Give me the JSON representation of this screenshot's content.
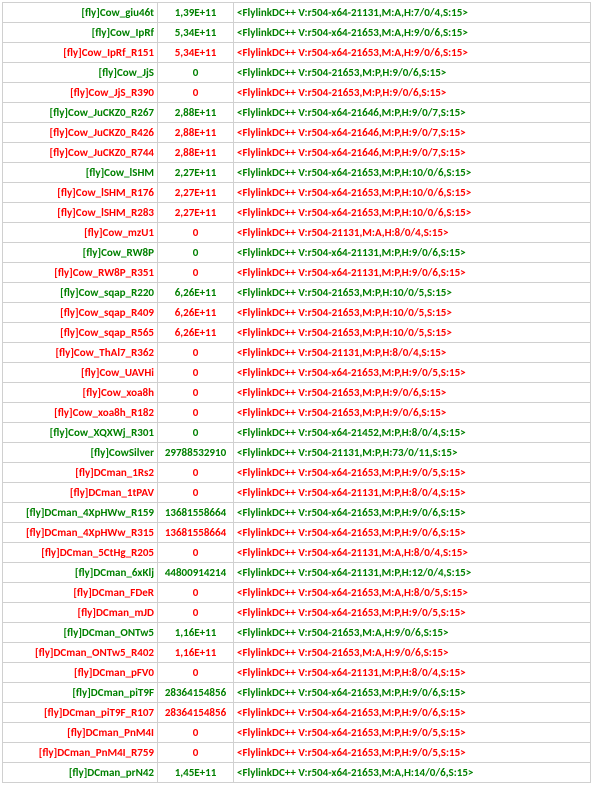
{
  "colors": {
    "green": "#008000",
    "red": "#ff0000"
  },
  "rows": [
    {
      "nick": "[fly]Cow_giu46t",
      "value": "1,39E+11",
      "info": "<FlylinkDC++ V:r504-x64-21131,M:A,H:7/0/4,S:15>",
      "color": "green"
    },
    {
      "nick": "[fly]Cow_IpRf",
      "value": "5,34E+11",
      "info": "<FlylinkDC++ V:r504-x64-21653,M:A,H:9/0/6,S:15>",
      "color": "green"
    },
    {
      "nick": "[fly]Cow_IpRf_R151",
      "value": "5,34E+11",
      "info": "<FlylinkDC++ V:r504-x64-21653,M:A,H:9/0/6,S:15>",
      "color": "red"
    },
    {
      "nick": "[fly]Cow_JjS",
      "value": "0",
      "info": "<FlylinkDC++ V:r504-21653,M:P,H:9/0/6,S:15>",
      "color": "green"
    },
    {
      "nick": "[fly]Cow_JjS_R390",
      "value": "0",
      "info": "<FlylinkDC++ V:r504-21653,M:P,H:9/0/6,S:15>",
      "color": "red"
    },
    {
      "nick": "[fly]Cow_JuCKZ0_R267",
      "value": "2,88E+11",
      "info": "<FlylinkDC++ V:r504-x64-21646,M:P,H:9/0/7,S:15>",
      "color": "green"
    },
    {
      "nick": "[fly]Cow_JuCKZ0_R426",
      "value": "2,88E+11",
      "info": "<FlylinkDC++ V:r504-x64-21646,M:P,H:9/0/7,S:15>",
      "color": "red"
    },
    {
      "nick": "[fly]Cow_JuCKZ0_R744",
      "value": "2,88E+11",
      "info": "<FlylinkDC++ V:r504-x64-21646,M:P,H:9/0/7,S:15>",
      "color": "red"
    },
    {
      "nick": "[fly]Cow_lSHM",
      "value": "2,27E+11",
      "info": "<FlylinkDC++ V:r504-x64-21653,M:P,H:10/0/6,S:15>",
      "color": "green"
    },
    {
      "nick": "[fly]Cow_lSHM_R176",
      "value": "2,27E+11",
      "info": "<FlylinkDC++ V:r504-x64-21653,M:P,H:10/0/6,S:15>",
      "color": "red"
    },
    {
      "nick": "[fly]Cow_lSHM_R283",
      "value": "2,27E+11",
      "info": "<FlylinkDC++ V:r504-x64-21653,M:P,H:10/0/6,S:15>",
      "color": "red"
    },
    {
      "nick": "[fly]Cow_mzU1",
      "value": "0",
      "info": "<FlylinkDC++ V:r504-21131,M:A,H:8/0/4,S:15>",
      "color": "red"
    },
    {
      "nick": "[fly]Cow_RW8P",
      "value": "0",
      "info": "<FlylinkDC++ V:r504-x64-21131,M:P,H:9/0/6,S:15>",
      "color": "green"
    },
    {
      "nick": "[fly]Cow_RW8P_R351",
      "value": "0",
      "info": "<FlylinkDC++ V:r504-x64-21131,M:P,H:9/0/6,S:15>",
      "color": "red"
    },
    {
      "nick": "[fly]Cow_sqap_R220",
      "value": "6,26E+11",
      "info": "<FlylinkDC++ V:r504-21653,M:P,H:10/0/5,S:15>",
      "color": "green"
    },
    {
      "nick": "[fly]Cow_sqap_R409",
      "value": "6,26E+11",
      "info": "<FlylinkDC++ V:r504-21653,M:P,H:10/0/5,S:15>",
      "color": "red"
    },
    {
      "nick": "[fly]Cow_sqap_R565",
      "value": "6,26E+11",
      "info": "<FlylinkDC++ V:r504-21653,M:P,H:10/0/5,S:15>",
      "color": "red"
    },
    {
      "nick": "[fly]Cow_ThAl7_R362",
      "value": "0",
      "info": "<FlylinkDC++ V:r504-21131,M:P,H:8/0/4,S:15>",
      "color": "red"
    },
    {
      "nick": "[fly]Cow_UAVHi",
      "value": "0",
      "info": "<FlylinkDC++ V:r504-x64-21653,M:P,H:9/0/5,S:15>",
      "color": "red"
    },
    {
      "nick": "[fly]Cow_xoa8h",
      "value": "0",
      "info": "<FlylinkDC++ V:r504-21653,M:P,H:9/0/6,S:15>",
      "color": "red"
    },
    {
      "nick": "[fly]Cow_xoa8h_R182",
      "value": "0",
      "info": "<FlylinkDC++ V:r504-21653,M:P,H:9/0/6,S:15>",
      "color": "red"
    },
    {
      "nick": "[fly]Cow_XQXWj_R301",
      "value": "0",
      "info": "<FlylinkDC++ V:r504-x64-21452,M:P,H:8/0/4,S:15>",
      "color": "green"
    },
    {
      "nick": "[fly]CowSilver",
      "value": "29788532910",
      "info": "<FlylinkDC++ V:r504-21131,M:P,H:73/0/11,S:15>",
      "color": "green"
    },
    {
      "nick": "[fly]DCman_1Rs2",
      "value": "0",
      "info": "<FlylinkDC++ V:r504-x64-21653,M:P,H:9/0/5,S:15>",
      "color": "red"
    },
    {
      "nick": "[fly]DCman_1tPAV",
      "value": "0",
      "info": "<FlylinkDC++ V:r504-x64-21131,M:P,H:8/0/4,S:15>",
      "color": "red"
    },
    {
      "nick": "[fly]DCman_4XpHWw_R159",
      "value": "13681558664",
      "info": "<FlylinkDC++ V:r504-x64-21653,M:P,H:9/0/6,S:15>",
      "color": "green"
    },
    {
      "nick": "[fly]DCman_4XpHWw_R315",
      "value": "13681558664",
      "info": "<FlylinkDC++ V:r504-x64-21653,M:P,H:9/0/6,S:15>",
      "color": "red"
    },
    {
      "nick": "[fly]DCman_5CtHg_R205",
      "value": "0",
      "info": "<FlylinkDC++ V:r504-x64-21131,M:A,H:8/0/4,S:15>",
      "color": "red"
    },
    {
      "nick": "[fly]DCman_6xKlj",
      "value": "44800914214",
      "info": "<FlylinkDC++ V:r504-x64-21131,M:P,H:12/0/4,S:15>",
      "color": "green"
    },
    {
      "nick": "[fly]DCman_FDeR",
      "value": "0",
      "info": "<FlylinkDC++ V:r504-x64-21653,M:A,H:8/0/5,S:15>",
      "color": "red"
    },
    {
      "nick": "[fly]DCman_mJD",
      "value": "0",
      "info": "<FlylinkDC++ V:r504-x64-21653,M:P,H:9/0/5,S:15>",
      "color": "red"
    },
    {
      "nick": "[fly]DCman_ONTw5",
      "value": "1,16E+11",
      "info": "<FlylinkDC++ V:r504-21653,M:A,H:9/0/6,S:15>",
      "color": "green"
    },
    {
      "nick": "[fly]DCman_ONTw5_R402",
      "value": "1,16E+11",
      "info": "<FlylinkDC++ V:r504-21653,M:A,H:9/0/6,S:15>",
      "color": "red"
    },
    {
      "nick": "[fly]DCman_pFV0",
      "value": "0",
      "info": "<FlylinkDC++ V:r504-x64-21131,M:P,H:8/0/4,S:15>",
      "color": "red"
    },
    {
      "nick": "[fly]DCman_piT9F",
      "value": "28364154856",
      "info": "<FlylinkDC++ V:r504-x64-21653,M:P,H:9/0/6,S:15>",
      "color": "green"
    },
    {
      "nick": "[fly]DCman_piT9F_R107",
      "value": "28364154856",
      "info": "<FlylinkDC++ V:r504-x64-21653,M:P,H:9/0/6,S:15>",
      "color": "red"
    },
    {
      "nick": "[fly]DCman_PnM4I",
      "value": "0",
      "info": "<FlylinkDC++ V:r504-x64-21653,M:P,H:9/0/5,S:15>",
      "color": "red"
    },
    {
      "nick": "[fly]DCman_PnM4I_R759",
      "value": "0",
      "info": "<FlylinkDC++ V:r504-x64-21653,M:P,H:9/0/5,S:15>",
      "color": "red"
    },
    {
      "nick": "[fly]DCman_prN42",
      "value": "1,45E+11",
      "info": "<FlylinkDC++ V:r504-x64-21653,M:A,H:14/0/6,S:15>",
      "color": "green"
    }
  ]
}
